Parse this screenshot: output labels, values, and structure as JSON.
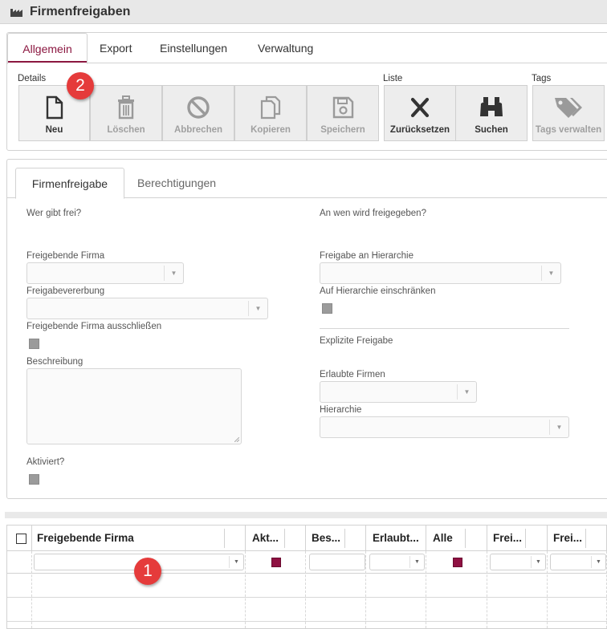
{
  "window": {
    "title": "Firmenfreigaben",
    "icon": "factory-icon"
  },
  "main_tabs": [
    {
      "label": "Allgemein",
      "active": true
    },
    {
      "label": "Export",
      "active": false
    },
    {
      "label": "Einstellungen",
      "active": false
    },
    {
      "label": "Verwaltung",
      "active": false
    }
  ],
  "toolbar": {
    "groups": {
      "details": "Details",
      "liste": "Liste",
      "tags": "Tags"
    },
    "buttons": [
      {
        "label": "Neu",
        "icon": "new-document-icon",
        "enabled": true
      },
      {
        "label": "Löschen",
        "icon": "trash-icon",
        "enabled": false
      },
      {
        "label": "Abbrechen",
        "icon": "cancel-icon",
        "enabled": false
      },
      {
        "label": "Kopieren",
        "icon": "copy-icon",
        "enabled": false
      },
      {
        "label": "Speichern",
        "icon": "save-icon",
        "enabled": false
      },
      {
        "label": "Zurücksetzen",
        "icon": "reset-x-icon",
        "enabled": true
      },
      {
        "label": "Suchen",
        "icon": "binoculars-icon",
        "enabled": true
      },
      {
        "label": "Tags verwalten",
        "icon": "tags-icon",
        "enabled": false
      }
    ]
  },
  "annotations": {
    "one": "1",
    "two": "2",
    "color": "#e53b3b"
  },
  "detail_tabs": [
    {
      "label": "Firmenfreigabe",
      "active": true
    },
    {
      "label": "Berechtigungen",
      "active": false
    }
  ],
  "form": {
    "left_heading": "Wer gibt frei?",
    "right_heading": "An wen wird freigegeben?",
    "freigebende_firma": "Freigebende Firma",
    "freigabevererbung": "Freigabevererbung",
    "firma_ausschliessen": "Freigebende Firma ausschließen",
    "beschreibung": "Beschreibung",
    "aktiviert": "Aktiviert?",
    "freigabe_hierarchie": "Freigabe an Hierarchie",
    "auf_hierarchie": "Auf Hierarchie einschränken",
    "explizite": "Explizite Freigabe",
    "erlaubte_firmen": "Erlaubte Firmen",
    "hierarchie": "Hierarchie"
  },
  "grid": {
    "columns": [
      "Freigebende Firma",
      "Akt...",
      "Bes...",
      "Erlaubt...",
      "Alle",
      "Frei...",
      "Frei..."
    ]
  },
  "colors": {
    "accent": "#8b1740",
    "checkbox_active": "#8f1142",
    "disabled_text": "#a0a0a0"
  }
}
